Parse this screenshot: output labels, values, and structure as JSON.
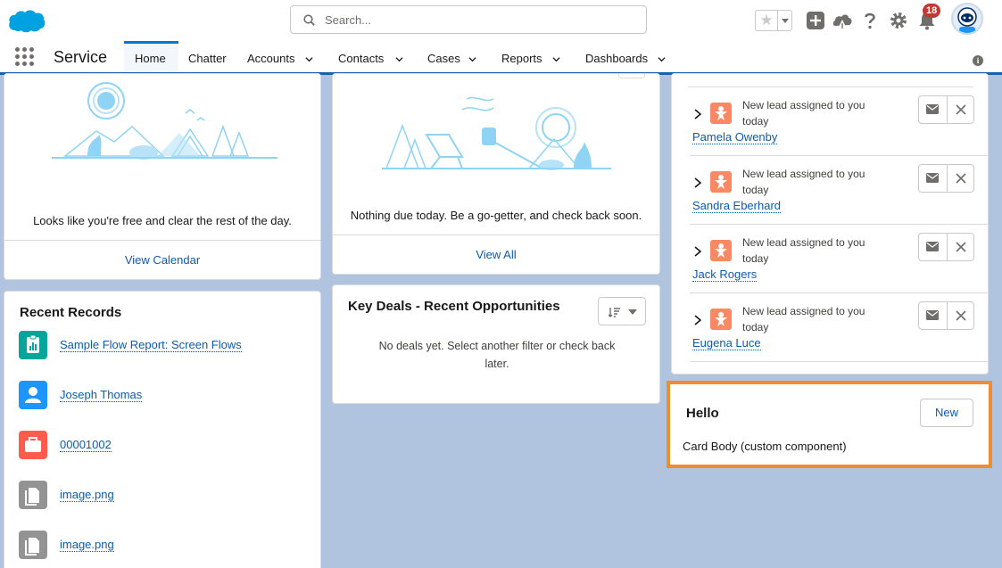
{
  "header": {
    "search_placeholder": "Search...",
    "notifications_count": "18",
    "colors": {
      "brand": "#00a1e0",
      "accent": "#0176d3",
      "highlight": "#f38b2f"
    },
    "icons": [
      "salesforce-cloud-logo",
      "search-icon",
      "favorites-star-icon",
      "add-icon",
      "trailhead-icon",
      "help-icon",
      "setup-gear-icon",
      "notification-bell-icon",
      "user-avatar"
    ]
  },
  "nav": {
    "app_name": "Service",
    "tabs": [
      {
        "label": "Home",
        "active": true,
        "has_menu": false
      },
      {
        "label": "Chatter",
        "active": false,
        "has_menu": false
      },
      {
        "label": "Accounts",
        "active": false,
        "has_menu": true
      },
      {
        "label": "Contacts",
        "active": false,
        "has_menu": true
      },
      {
        "label": "Cases",
        "active": false,
        "has_menu": true
      },
      {
        "label": "Reports",
        "active": false,
        "has_menu": true
      },
      {
        "label": "Dashboards",
        "active": false,
        "has_menu": true
      }
    ]
  },
  "calendar_card": {
    "message": "Looks like you're free and clear the rest of the day.",
    "footer_link": "View Calendar"
  },
  "tasks_card": {
    "message": "Nothing due today. Be a go-getter, and check back soon.",
    "footer_link": "View All"
  },
  "recent_records": {
    "title": "Recent Records",
    "items": [
      {
        "name": "Sample Flow Report: Screen Flows",
        "icon": "report-icon",
        "color": "#06a59a"
      },
      {
        "name": "Joseph Thomas",
        "icon": "contact-icon",
        "color": "#1b96ff"
      },
      {
        "name": "00001002",
        "icon": "case-icon",
        "color": "#fe5c4c"
      },
      {
        "name": "image.png",
        "icon": "file-icon",
        "color": "#939393"
      },
      {
        "name": "image.png",
        "icon": "file-icon",
        "color": "#939393"
      }
    ]
  },
  "key_deals": {
    "title": "Key Deals - Recent Opportunities",
    "message": "No deals yet. Select another filter or check back later."
  },
  "leads": {
    "items": [
      {
        "text": "New lead assigned to you today",
        "name": "Pamela Owenby"
      },
      {
        "text": "New lead assigned to you today",
        "name": "Sandra Eberhard"
      },
      {
        "text": "New lead assigned to you today",
        "name": "Jack Rogers"
      },
      {
        "text": "New lead assigned to you today",
        "name": "Eugena Luce"
      }
    ]
  },
  "hello_card": {
    "title": "Hello",
    "button": "New",
    "body": "Card Body (custom component)"
  }
}
